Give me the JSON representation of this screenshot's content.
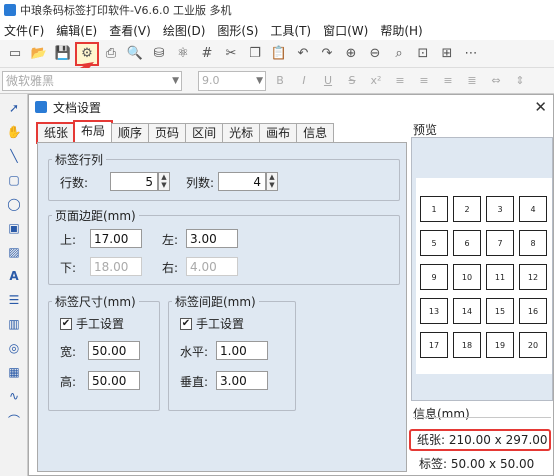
{
  "window_title": "中琅条码标签打印软件-V6.6.0 工业版 多机",
  "menu": [
    "文件(F)",
    "编辑(E)",
    "查看(V)",
    "绘图(D)",
    "图形(S)",
    "工具(T)",
    "窗口(W)",
    "帮助(H)"
  ],
  "font_box": "微软雅黑",
  "size_box": "9.0",
  "dialog": {
    "title": "文档设置",
    "tabs": [
      "纸张",
      "布局",
      "顺序",
      "页码",
      "区间",
      "光标",
      "画布",
      "信息"
    ],
    "rowcol": {
      "legend": "标签行列",
      "rows_label": "行数:",
      "rows": "5",
      "cols_label": "列数:",
      "cols": "4"
    },
    "margin": {
      "legend": "页面边距(mm)",
      "top_label": "上:",
      "top": "17.00",
      "left_label": "左:",
      "left": "3.00",
      "bottom_label": "下:",
      "bottom": "18.00",
      "right_label": "右:",
      "right": "4.00"
    },
    "size": {
      "legend": "标签尺寸(mm)",
      "manual": "手工设置",
      "width_label": "宽:",
      "width": "50.00",
      "height_label": "高:",
      "height": "50.00"
    },
    "spacing": {
      "legend": "标签间距(mm)",
      "manual": "手工设置",
      "h_label": "水平:",
      "h": "1.00",
      "v_label": "垂直:",
      "v": "3.00"
    },
    "preview_label": "预览",
    "cells": [
      "1",
      "2",
      "3",
      "4",
      "5",
      "6",
      "7",
      "8",
      "9",
      "10",
      "11",
      "12",
      "13",
      "14",
      "15",
      "16",
      "17",
      "18",
      "19",
      "20"
    ],
    "info_label": "信息(mm)",
    "info_paper": "纸张: 210.00 x 297.00",
    "info_label_size": "标签: 50.00 x 50.00"
  },
  "colors": {
    "highlight": "#e53935",
    "panel": "#dfe8f2",
    "accent": "#2a7bd5"
  }
}
